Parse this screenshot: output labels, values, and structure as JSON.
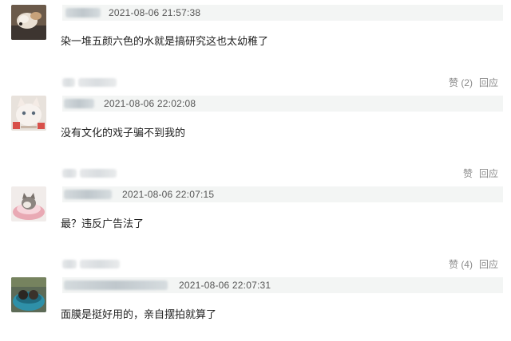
{
  "comments": [
    {
      "timestamp": "2021-08-06 21:57:38",
      "text": "染一堆五颜六色的水就是搞研究这也太幼稚了",
      "like_label": "赞",
      "like_count": "(2)",
      "reply_label": "回应"
    },
    {
      "timestamp": "2021-08-06 22:02:08",
      "text": "没有文化的戏子骗不到我的",
      "like_label": "赞",
      "like_count": "",
      "reply_label": "回应"
    },
    {
      "timestamp": "2021-08-06 22:07:15",
      "text": "最？违反广告法了",
      "like_label": "赞",
      "like_count": "(4)",
      "reply_label": "回应"
    },
    {
      "timestamp": "2021-08-06 22:07:31",
      "text": "面膜是挺好用的，亲自摆拍就算了"
    }
  ]
}
